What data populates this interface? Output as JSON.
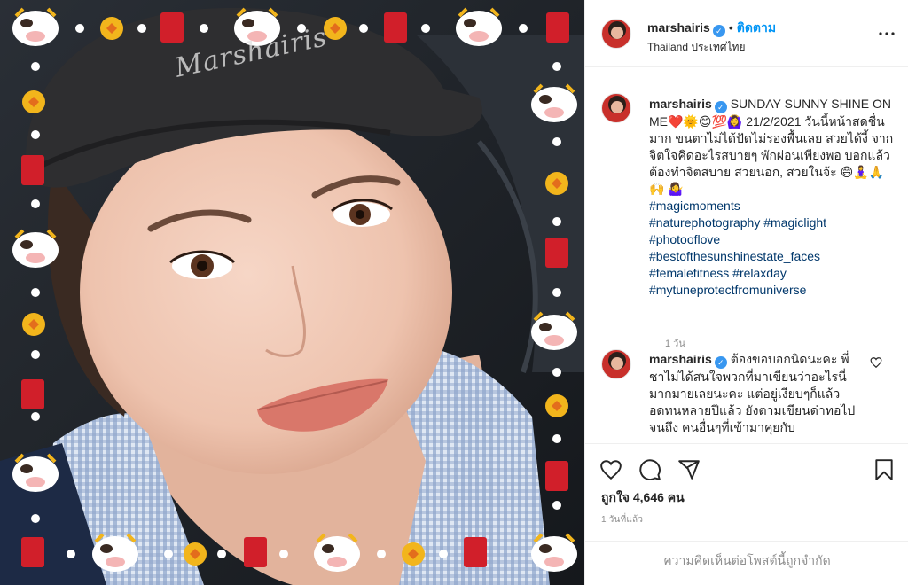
{
  "post": {
    "watermark": "Marshairis",
    "location": "Thailand ประเทศไทย",
    "follow_label": "ติดตาม",
    "header_dot": "•"
  },
  "author": {
    "username": "marshairis",
    "verified_mark": "✓"
  },
  "caption": {
    "text": "SUNDAY SUNNY SHINE ON ME❤️🌞😊💯🙆‍♀️ 21/2/2021 วันนี้หน้าสดชื่นมาก ขนตาไม่ได้ปัดไม่รองพื้นเลย สวยได้งี้ จากจิตใจคิดอะไรสบายๆ พักผ่อนเพียงพอ บอกแล้วต้องทำจิตสบาย สวยนอก, สวยในจ้ะ 😄🧘‍♀️🙏🙌 🤷‍♀️",
    "hashtags": [
      "#magicmoments",
      "#naturephotography #magiclight",
      "#photooflove",
      "#bestofthesunshinestate_faces",
      "#femalefitness #relaxday",
      "#mytuneprotectfromuniverse"
    ],
    "time": "1 วัน"
  },
  "comment": {
    "username": "marshairis",
    "text": "ต้องขอบอกนิดนะคะ พี่ชาไม่ได้สนใจพวกที่มาเขียนว่าอะไรนี่มากมายเลยนะคะ แต่อยู่เงียบๆก็แล้ว อดทนหลายปีแล้ว ยังตามเขียนด่าทอไปจนถึง คนอื่นๆที่เข้ามาคุยกับ"
  },
  "actions": {
    "likes": "ถูกใจ 4,646 คน",
    "post_time": "1 วันที่แล้ว",
    "comments_limited": "ความคิดเห็นต่อโพสต์นี้ถูกจำกัด"
  },
  "icons": {
    "more": "more-options-icon",
    "like": "heart-icon",
    "comment": "comment-icon",
    "share": "share-icon",
    "save": "bookmark-icon",
    "comment_like": "small-heart-icon"
  },
  "colors": {
    "link": "#00376b",
    "follow": "#0095f6",
    "verified": "#3897f0",
    "muted": "#8e8e8e"
  }
}
